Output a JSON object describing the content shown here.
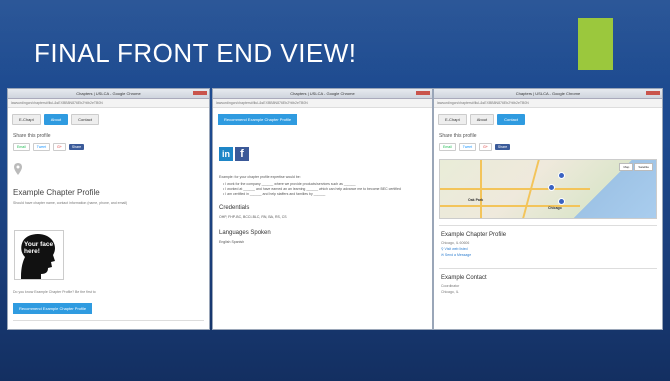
{
  "slide": {
    "title": "FINAL FRONT END VIEW!",
    "accent_color": "#9bc83d",
    "background_color": "#1d4a8f"
  },
  "browser": {
    "window_title": "Chapters | USLCA - Google Chrome",
    "url": "lawsurdingcn/chapters#!lluL&sEXBB8N876Eb2%lb2eTB0N"
  },
  "left_panel": {
    "tabs": [
      "E-Chapt",
      "About",
      "Contact"
    ],
    "active_tab": "About",
    "share_label": "Share this profile",
    "share_buttons": [
      "Email",
      "Tweet",
      "G+",
      "Share"
    ],
    "profile_title": "Example Chapter Profile",
    "description": "Should have chapter name, contact information (name, phone, and email)",
    "face_text": "Your face here!",
    "recommend_prompt": "Do you know Example Chapter Profile? Be the first to",
    "recommend_button": "Recommend Example Chapter Profile"
  },
  "middle_panel": {
    "recommend_button": "Recommend Example Chapter Profile",
    "social_icons": [
      "in",
      "f"
    ],
    "intro": "Example: for your chapter profile expertise would be:",
    "bullets": [
      "I work for the company ______ where we provide products/services such as ______",
      "I worked at ______ and have earned an an learning ______ which can help advance me to become BEC certified",
      "I am certified in ______ and help staffers and families by ______"
    ],
    "credentials_title": "Credentials",
    "credentials_text": "OHP, FHP-BC, BCCI-BLC, RN, BA, RS, CS",
    "languages_title": "Languages Spoken",
    "languages_text": "English Spanish"
  },
  "right_panel": {
    "tabs": [
      "E-Chapt",
      "About",
      "Contact"
    ],
    "active_tab": "Contact",
    "share_label": "Share this profile",
    "share_buttons": [
      "Email",
      "Tweet",
      "G+",
      "Share"
    ],
    "map_buttons": [
      "Map",
      "Satellite"
    ],
    "map_labels": [
      "Oak Park",
      "Chicago"
    ],
    "profile_title": "Example Chapter Profile",
    "profile_location": "Chicago, IL 60606",
    "profile_links": [
      "Visit web listed",
      "Send a Message"
    ],
    "contact_title": "Example Contact",
    "contact_role": "Coordinator",
    "contact_location": "Chicago, IL"
  }
}
